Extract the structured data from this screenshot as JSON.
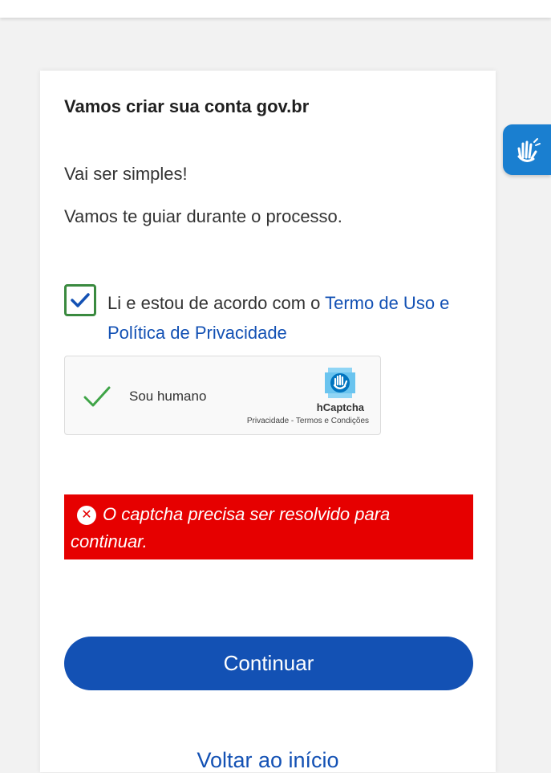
{
  "header": {
    "title": "Vamos criar sua conta gov.br"
  },
  "intro": {
    "line1": "Vai ser simples!",
    "line2": "Vamos te guiar durante o processo."
  },
  "consent": {
    "checked": true,
    "text": "Li e estou de acordo com o ",
    "link": "Termo de Uso e Política de Privacidade"
  },
  "captcha": {
    "label": "Sou humano",
    "brand": "hCaptcha",
    "links": "Privacidade - Termos e Condições"
  },
  "error": {
    "message": "O captcha precisa ser resolvido para continuar."
  },
  "actions": {
    "continue_label": "Continuar",
    "back_label": "Voltar ao início"
  },
  "icons": {
    "accessibility": "sign-language-hand-icon",
    "checkbox": "checkmark-icon",
    "captcha_check": "checkmark-icon",
    "captcha_logo": "hcaptcha-logo-icon",
    "error": "error-x-circle-icon"
  },
  "colors": {
    "primary": "#1351b4",
    "error": "#e60000",
    "check_green": "#3a8a3f",
    "a11y_blue": "#1a7fd0"
  }
}
